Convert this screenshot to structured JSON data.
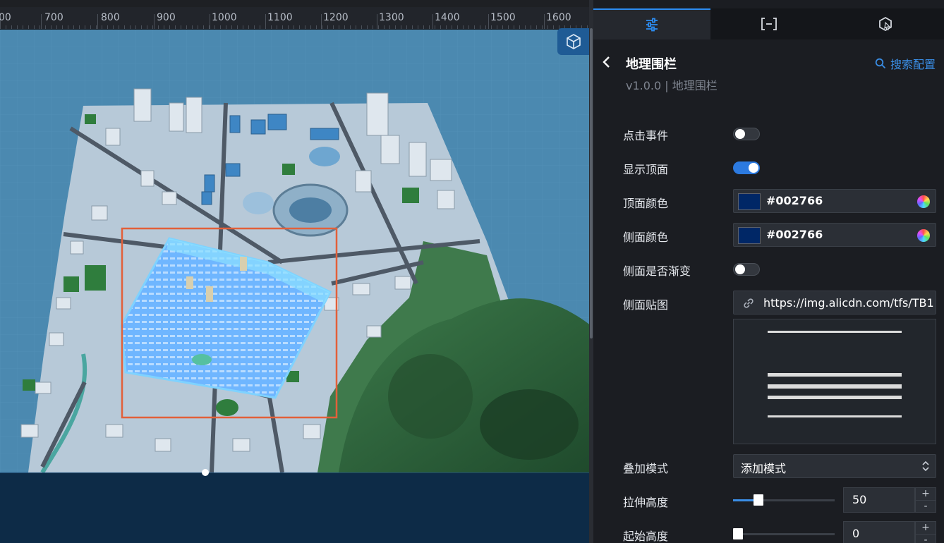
{
  "ruler": {
    "ticks": [
      "00",
      "700",
      "800",
      "900",
      "1000",
      "1100",
      "1200",
      "1300",
      "1400",
      "1500",
      "1600"
    ]
  },
  "canvas": {
    "view_cube_icon": "cube-icon",
    "selection_color": "#e2603a",
    "geofence_color": "#4ea8ff",
    "map_base_color": "#b7c9d8",
    "terrain_color": "#3f7a4c",
    "background_color": "#4b89b0"
  },
  "tabs": [
    {
      "icon": "sliders-icon",
      "active": true
    },
    {
      "icon": "bracket-icon",
      "active": false
    },
    {
      "icon": "interaction-icon",
      "active": false
    }
  ],
  "component": {
    "title": "地理围栏",
    "subtitle": "v1.0.0 | 地理围栏",
    "search_label": "搜索配置"
  },
  "settings": {
    "click_event": {
      "label": "点击事件",
      "on": false
    },
    "show_top": {
      "label": "显示顶面",
      "on": true
    },
    "top_color": {
      "label": "顶面颜色",
      "value": "#002766"
    },
    "side_color": {
      "label": "侧面颜色",
      "value": "#002766"
    },
    "side_gradient": {
      "label": "侧面是否渐变",
      "on": false
    },
    "side_texture": {
      "label": "侧面贴图",
      "url": "https://img.alicdn.com/tfs/TB1"
    },
    "blend_mode": {
      "label": "叠加模式",
      "value": "添加模式"
    },
    "stretch_height": {
      "label": "拉伸高度",
      "value": "50",
      "fraction": 0.25
    },
    "start_height": {
      "label": "起始高度",
      "value": "0",
      "fraction": 0.0
    }
  }
}
